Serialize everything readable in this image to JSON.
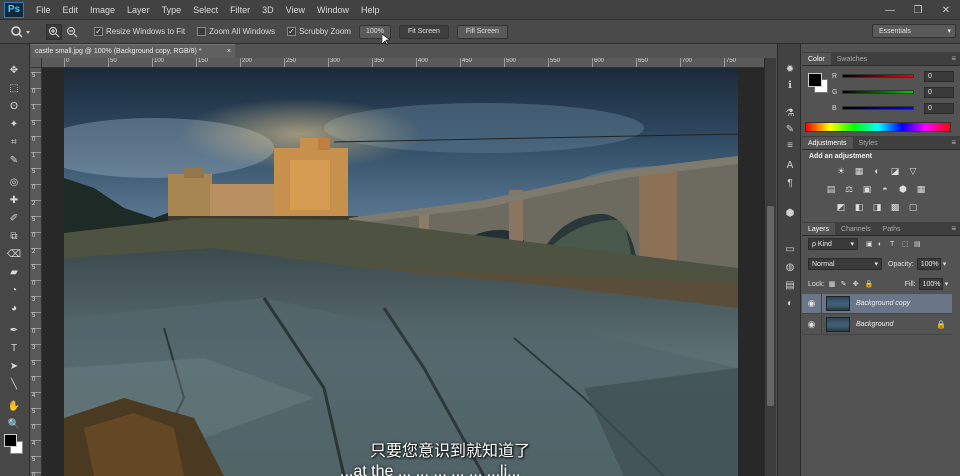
{
  "app": {
    "logo": "Ps",
    "document_tab": "castle small.jpg @ 100% (Background copy, RGB/8) *",
    "close_glyph": "×"
  },
  "menu": [
    "File",
    "Edit",
    "Image",
    "Layer",
    "Type",
    "Select",
    "Filter",
    "3D",
    "View",
    "Window",
    "Help"
  ],
  "window_controls": {
    "minimize": "—",
    "restore": "❐",
    "close": "✕"
  },
  "options": {
    "resize_windows": "Resize Windows to Fit",
    "zoom_all_windows": "Zoom All Windows",
    "scrubby_zoom": "Scrubby Zoom",
    "zoom_value": "100%",
    "fit_screen": "Fit Screen",
    "fill_screen": "Fill Screen",
    "checked_glyph": "✓",
    "workspace": "Essentials",
    "workspace_arrow": "▾"
  },
  "ruler_h": [
    "0",
    "50",
    "100",
    "150",
    "200",
    "250",
    "300",
    "350",
    "400",
    "450",
    "500",
    "550",
    "600",
    "650",
    "700",
    "750"
  ],
  "ruler_v": [
    "5",
    "0",
    "1",
    "5",
    "0",
    "1",
    "5",
    "0",
    "2",
    "5",
    "0",
    "2",
    "5",
    "0",
    "3",
    "5",
    "0",
    "3",
    "5",
    "0",
    "4",
    "5",
    "0",
    "4",
    "5",
    "0"
  ],
  "subtitle": {
    "line1": "只要您意识到就知道了",
    "line2": "...at the ... ... ... ... ... ...li..."
  },
  "color_panel": {
    "tabs": [
      "Color",
      "Swatches"
    ],
    "menu_glyph": "≡",
    "channels": [
      {
        "label": "R",
        "value": "0",
        "color": "#d03030"
      },
      {
        "label": "G",
        "value": "0",
        "color": "#30a030"
      },
      {
        "label": "B",
        "value": "0",
        "color": "#3040d0"
      }
    ]
  },
  "adjustments_panel": {
    "tabs": [
      "Adjustments",
      "Styles"
    ],
    "menu_glyph": "≡",
    "title": "Add an adjustment",
    "icons_row1": [
      "☀",
      "▦",
      "◐",
      "◪",
      "▽"
    ],
    "icons_row2": [
      "▤",
      "⚖",
      "▣",
      "◓",
      "⬢",
      "▦"
    ],
    "icons_row3": [
      "◩",
      "◧",
      "◨",
      "▩",
      "▢"
    ]
  },
  "layers_panel": {
    "tabs": [
      "Layers",
      "Channels",
      "Paths"
    ],
    "menu_glyph": "≡",
    "kind_label": "ρ Kind",
    "kind_arrow": "▾",
    "kind_filter_icons": [
      "▣",
      "◐",
      "T",
      "⬚",
      "▤"
    ],
    "blend_mode": "Normal",
    "opacity_label": "Opacity:",
    "opacity_value": "100%",
    "lock_label": "Lock:",
    "lock_icons": [
      "▦",
      "✎",
      "✥",
      "🔒"
    ],
    "fill_label": "Fill:",
    "fill_value": "100%",
    "eye_glyph": "◉",
    "layers": [
      {
        "name": "Background copy",
        "active": true,
        "locked": false
      },
      {
        "name": "Background",
        "active": false,
        "locked": true,
        "lock_glyph": "🔒"
      }
    ]
  },
  "tools": [
    "✥",
    "⬚",
    "ʘ",
    "✦",
    "⌗",
    "✎",
    "◎",
    "✚",
    "✐",
    "⧉",
    "⌫",
    "▰",
    "◔",
    "◕",
    "✒",
    "T",
    "➤",
    "╲",
    "✋",
    "🔍"
  ],
  "panel_strip_icons": [
    "✹",
    "ℹ",
    "⚗",
    "✎",
    "≡",
    "A",
    "¶",
    "⬢",
    "▭",
    "◍",
    "▤",
    "◐"
  ]
}
